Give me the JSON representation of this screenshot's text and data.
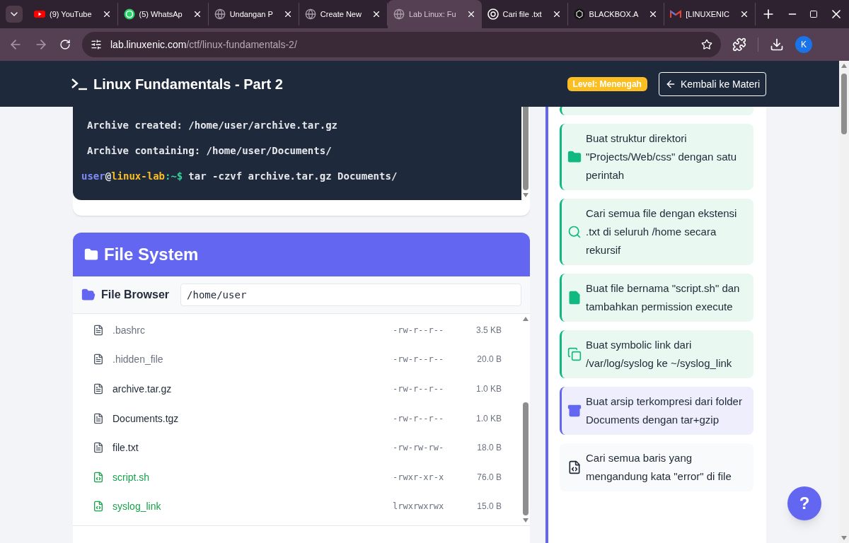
{
  "browser": {
    "tabs": [
      {
        "label": "(9) YouTube",
        "selected": false
      },
      {
        "label": "(5) WhatsAp",
        "selected": false
      },
      {
        "label": "Undangan P",
        "selected": false
      },
      {
        "label": "Create New",
        "selected": false
      },
      {
        "label": "Lab Linux: Fu",
        "selected": true
      },
      {
        "label": "Cari file .txt",
        "selected": false
      },
      {
        "label": "BLACKBOX.A",
        "selected": false
      },
      {
        "label": "[LINUXENIC",
        "selected": false
      }
    ],
    "url_host": "lab.linuxenic.com",
    "url_path": "/ctf/linux-fundamentals-2/",
    "profile": "K"
  },
  "header": {
    "title": "Linux Fundamentals - Part 2",
    "level_badge": "Level: Menengah",
    "back_button": "Kembali ke Materi"
  },
  "terminal": {
    "lines": [
      {
        "kind": "output",
        "parts": [
          {
            "kind": "plain",
            "text": "Archive created: /home/user/archive.tar.gz"
          }
        ]
      },
      {
        "kind": "output",
        "parts": [
          {
            "kind": "plain",
            "text": "Archive containing: /home/user/Documents/"
          }
        ]
      },
      {
        "kind": "prompt",
        "parts": [
          {
            "kind": "user",
            "text": "user"
          },
          {
            "kind": "plain",
            "text": "@"
          },
          {
            "kind": "host",
            "text": "linux-lab"
          },
          {
            "kind": "path",
            "text": ":~$"
          },
          {
            "kind": "command",
            "text": "tar -czvf archive.tar.gz Documents/"
          }
        ]
      }
    ]
  },
  "file_system": {
    "title": "File System",
    "browser_label": "File Browser",
    "path": "/home/user",
    "files": [
      {
        "name": ".bashrc",
        "kind": "hidden",
        "permissions": "-rw-r--r--",
        "size": "3.5 KB"
      },
      {
        "name": ".hidden_file",
        "kind": "hidden",
        "permissions": "-rw-r--r--",
        "size": "20.0 B"
      },
      {
        "name": "archive.tar.gz",
        "kind": "file",
        "permissions": "-rw-r--r--",
        "size": "1.0 KB"
      },
      {
        "name": "Documents.tgz",
        "kind": "file",
        "permissions": "-rw-r--r--",
        "size": "1.0 KB"
      },
      {
        "name": "file.txt",
        "kind": "file",
        "permissions": "-rw-rw-rw-",
        "size": "18.0 B"
      },
      {
        "name": "script.sh",
        "kind": "executable",
        "permissions": "-rwxr-xr-x",
        "size": "76.0 B"
      },
      {
        "name": "syslog_link",
        "kind": "executable",
        "permissions": "lrwxrwxrwx",
        "size": "15.0 B"
      }
    ]
  },
  "tasks": [
    {
      "completed": true,
      "active": false
    },
    {
      "completed": true,
      "active": false,
      "text": "Buat struktur direktori \"Projects/Web/css\" dengan satu perintah"
    },
    {
      "completed": true,
      "active": false,
      "text": "Cari semua file dengan ekstensi .txt di seluruh /home secara rekursif"
    },
    {
      "completed": true,
      "active": false,
      "text": "Buat file bernama \"script.sh\" dan tambahkan permission execute"
    },
    {
      "completed": true,
      "active": false,
      "text": "Buat symbolic link dari /var/log/syslog ke ~/syslog_link"
    },
    {
      "completed": false,
      "active": true,
      "text": "Buat arsip terkompresi dari folder Documents dengan tar+gzip"
    },
    {
      "completed": false,
      "active": false,
      "text": "Cari semua baris yang mengandung kata \"error\" di file"
    }
  ],
  "help_button": "?"
}
